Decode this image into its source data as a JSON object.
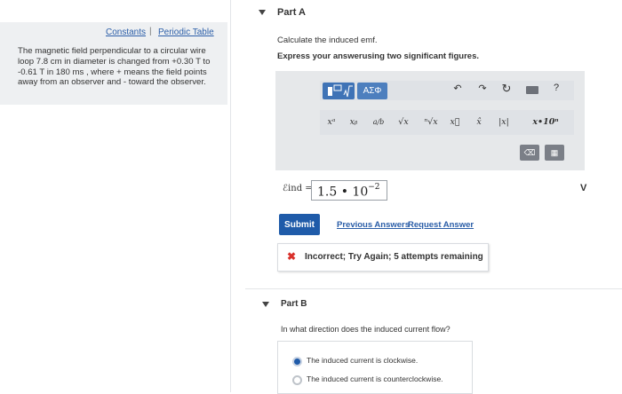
{
  "left": {
    "constants_link": "Constants",
    "separator": "|",
    "periodic_link": "Periodic Table",
    "problem_text": "The magnetic field perpendicular to a circular wire loop 7.8 cm in diameter is changed from +0.30 T to -0.61 T in 180 ms , where + means the field points away from an observer and - toward the observer."
  },
  "partA": {
    "title": "Part A",
    "prompt": "Calculate the induced emf.",
    "instruction": "Express your answerusing two significant figures.",
    "toolbar": {
      "greek_label": "ΑΣΦ",
      "undo_icon": "↶",
      "redo_icon": "↷",
      "reset_icon": "↻",
      "keyboard_icon": "▭",
      "help_icon": "?",
      "math_buttons": [
        "xᵃ",
        "xᵦ",
        "a/b",
        "√x",
        "ⁿ√x",
        "x⃗",
        "x̂",
        "|x|",
        "x•10ⁿ"
      ],
      "delete_icon": "⌫",
      "calc_icon": "▦"
    },
    "label_html": "ℰind =",
    "answer_mantissa": "1.5 • 10",
    "answer_exponent": "−2",
    "unit": "V",
    "submit_label": "Submit",
    "prev_answers": "Previous Answers",
    "request_answer": "Request Answer",
    "feedback_icon": "✖",
    "feedback_text": "Incorrect; Try Again; 5 attempts remaining"
  },
  "partB": {
    "title": "Part B",
    "prompt": "In what direction does the induced current flow?",
    "options": [
      "The induced current is clockwise.",
      "The induced current is counterclockwise."
    ]
  },
  "colors": {
    "accent": "#1f5ba9",
    "error": "#d9312b",
    "panel_bg": "#eef0f2"
  }
}
